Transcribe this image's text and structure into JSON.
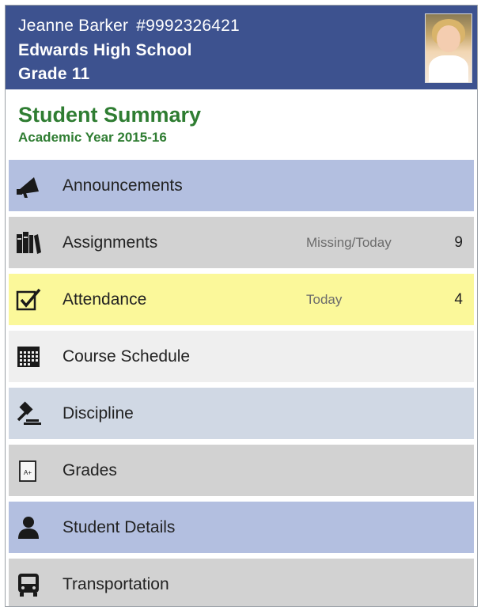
{
  "student": {
    "name": "Jeanne Barker",
    "id": "#9992326421",
    "school": "Edwards High School",
    "grade": "Grade 11"
  },
  "summary": {
    "title": "Student Summary",
    "year": "Academic Year 2015-16"
  },
  "colors": {
    "header": "#3d528f",
    "title_green": "#2f7d32",
    "announcements": "#b3bfe0",
    "assignments": "#d2d2d2",
    "attendance": "#fbf89a",
    "course_schedule": "#efefef",
    "discipline": "#d0d8e4",
    "grades": "#d2d2d2",
    "student_details": "#b3bfe0",
    "transportation": "#d2d2d2"
  },
  "menu": {
    "announcements": {
      "label": "Announcements",
      "icon": "megaphone-icon"
    },
    "assignments": {
      "label": "Assignments",
      "sub": "Missing/Today",
      "count": "9",
      "icon": "books-icon"
    },
    "attendance": {
      "label": "Attendance",
      "sub": "Today",
      "count": "4",
      "icon": "checkbox-icon"
    },
    "course_schedule": {
      "label": "Course Schedule",
      "icon": "calendar-icon"
    },
    "discipline": {
      "label": "Discipline",
      "icon": "gavel-icon"
    },
    "grades": {
      "label": "Grades",
      "icon": "grade-report-icon",
      "icon_text": "A+"
    },
    "student_details": {
      "label": "Student Details",
      "icon": "person-icon"
    },
    "transportation": {
      "label": "Transportation",
      "icon": "bus-icon"
    }
  }
}
